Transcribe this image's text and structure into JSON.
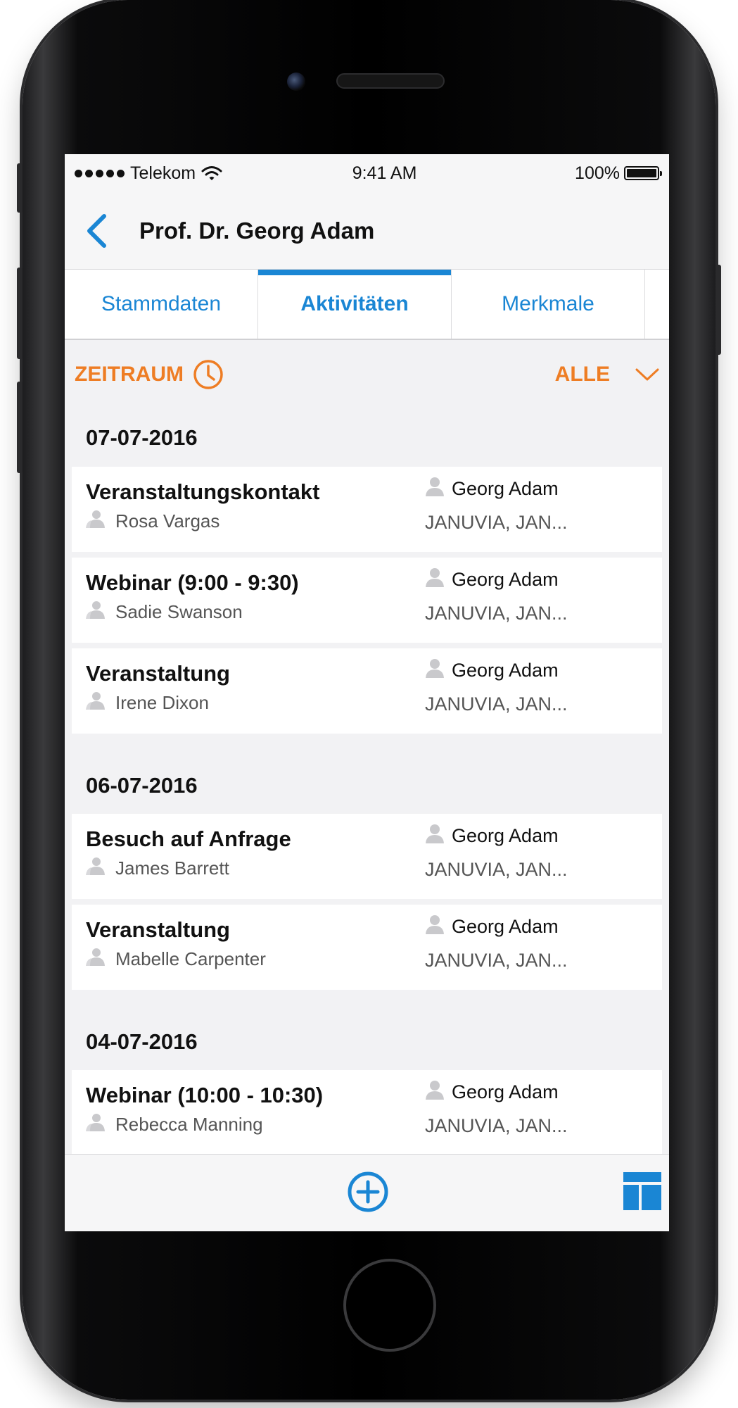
{
  "status": {
    "carrier": "Telekom",
    "time": "9:41 AM",
    "battery": "100%"
  },
  "header": {
    "title": "Prof. Dr. Georg Adam"
  },
  "tabs": [
    {
      "label": "Stammdaten"
    },
    {
      "label": "Aktivitäten"
    },
    {
      "label": "Merkmale"
    }
  ],
  "filter": {
    "period_label": "ZEITRAUM",
    "type_value": "ALLE"
  },
  "colors": {
    "accent_blue": "#1a86d4",
    "accent_orange": "#ee7d24"
  },
  "groups": [
    {
      "date": "07-07-2016",
      "items": [
        {
          "title": "Veranstaltungskontakt",
          "person": "Rosa Vargas",
          "owner": "Georg Adam",
          "tags": "JANUVIA, JAN..."
        },
        {
          "title": "Webinar (9:00 - 9:30)",
          "person": "Sadie Swanson",
          "owner": "Georg Adam",
          "tags": "JANUVIA, JAN..."
        },
        {
          "title": "Veranstaltung",
          "person": "Irene Dixon",
          "owner": "Georg Adam",
          "tags": "JANUVIA, JAN..."
        }
      ]
    },
    {
      "date": "06-07-2016",
      "items": [
        {
          "title": "Besuch auf Anfrage",
          "person": "James Barrett",
          "owner": "Georg Adam",
          "tags": "JANUVIA, JAN..."
        },
        {
          "title": "Veranstaltung",
          "person": "Mabelle Carpenter",
          "owner": "Georg Adam",
          "tags": "JANUVIA, JAN..."
        }
      ]
    },
    {
      "date": "04-07-2016",
      "items": [
        {
          "title": "Webinar (10:00 - 10:30)",
          "person": "Rebecca Manning",
          "owner": "Georg Adam",
          "tags": "JANUVIA, JAN..."
        }
      ]
    }
  ],
  "icons": {
    "back": "chevron-left-icon",
    "period": "clock-icon",
    "dropdown": "chevron-down-icon",
    "contact": "contact-person-icon",
    "owner": "owner-person-icon",
    "add": "plus-circle-icon",
    "layout": "layout-grid-icon"
  }
}
